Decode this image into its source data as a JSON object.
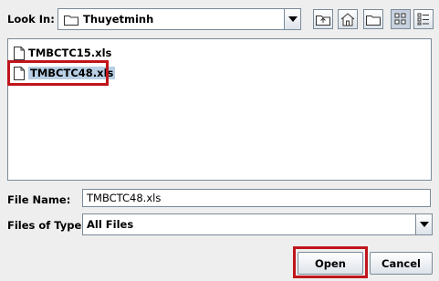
{
  "look_in": {
    "label": "Look In:",
    "folder": "Thuyetminh",
    "icon": "folder-icon"
  },
  "toolbar": {
    "up_icon": "up-folder-icon",
    "home_icon": "home-icon",
    "new_folder_icon": "new-folder-icon",
    "list_view_icon": "list-view-icon",
    "details_view_icon": "details-view-icon"
  },
  "files": [
    {
      "name": "TMBCTC15.xls",
      "selected": false
    },
    {
      "name": "TMBCTC48.xls",
      "selected": true
    }
  ],
  "file_name": {
    "label": "File Name:",
    "value": "TMBCTC48.xls"
  },
  "file_type": {
    "label": "Files of Type:",
    "value": "All Files"
  },
  "buttons": {
    "open": "Open",
    "cancel": "Cancel"
  },
  "colors": {
    "highlight_red": "#c0151b",
    "selection": "#b8cfe5"
  }
}
